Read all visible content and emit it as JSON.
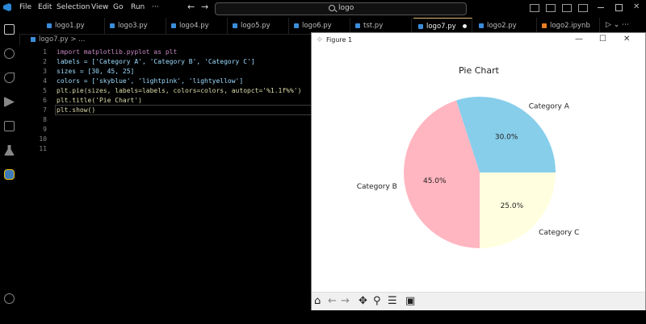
{
  "menu": [
    "File",
    "Edit",
    "Selection",
    "View",
    "Go",
    "Run",
    "···"
  ],
  "search": {
    "text": "logo"
  },
  "tabs": [
    {
      "label": "logo1.py"
    },
    {
      "label": "logo3.py"
    },
    {
      "label": "logo4.py"
    },
    {
      "label": "logo5.py"
    },
    {
      "label": "logo6.py"
    },
    {
      "label": "tst.py"
    },
    {
      "label": "logo7.py"
    },
    {
      "label": "logo2.py"
    },
    {
      "label": "logo2.ipynb"
    }
  ],
  "breadcrumb": "logo7.py >  ...",
  "lines": [
    "1",
    "2",
    "3",
    "4",
    "5",
    "6",
    "7",
    "8",
    "9",
    "10",
    "11"
  ],
  "code": [
    "import matplotlib.pyplot as plt",
    "labels = ['Category A', 'Category B', 'Category C']",
    "sizes = [30, 45, 25]",
    "colors = ['skyblue', 'lightpink', 'lightyellow']",
    "plt.pie(sizes, labels=labels, colors=colors, autopct='%1.1f%%')",
    "plt.title('Pie Chart')",
    "plt.show()"
  ],
  "figure": {
    "title": "Figure 1"
  },
  "chart_data": {
    "type": "pie",
    "title": "Pie Chart",
    "categories": [
      "Category A",
      "Category B",
      "Category C"
    ],
    "values": [
      30,
      45,
      25
    ],
    "colors": [
      "#87ceeb",
      "#ffb6c1",
      "#ffffe0"
    ],
    "labels_pct": [
      "30.0%",
      "45.0%",
      "25.0%"
    ]
  }
}
